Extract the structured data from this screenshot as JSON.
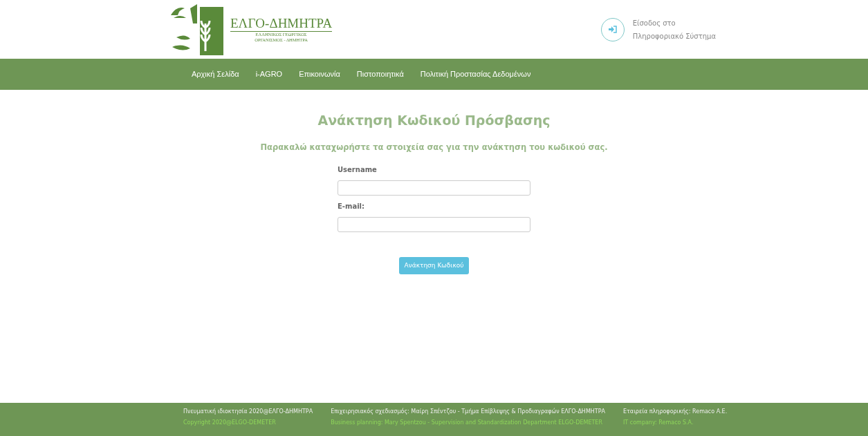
{
  "logo": {
    "title": "ΕΛΓΟ-ΔΗΜΗΤΡΑ",
    "subtitle_lines": [
      "ΕΛΛΗΝΙΚΟΣ ΓΕΩΡΓΙΚΟΣ",
      "ΟΡΓΑΝΙΣΜΟΣ - ΔΗΜΗΤΡΑ"
    ]
  },
  "login_link": {
    "lines": [
      "Είσοδος στο",
      "Πληροφοριακό Σύστημα"
    ]
  },
  "nav": [
    {
      "label": "Αρχική Σελίδα"
    },
    {
      "label": "i-AGRO"
    },
    {
      "label": "Επικοινωνία"
    },
    {
      "label": "Πιστοποιητικά"
    },
    {
      "label": "Πολιτική Προστασίας Δεδομένων"
    }
  ],
  "form": {
    "title": "Ανάκτηση Κωδικού Πρόσβασης",
    "instructions": "Παρακαλώ καταχωρήστε τα στοιχεία σας για την ανάκτηση του κωδικού σας.",
    "fields": [
      {
        "label": "Username"
      },
      {
        "label": "E-mail:"
      }
    ],
    "submit": "Ανάκτηση Κωδικού"
  },
  "footer": [
    {
      "main": "Πνευματική ιδιοκτησία 2020@ΕΛΓΟ-ΔΗΜΗΤΡΑ",
      "sub": "Copyright 2020@ELGO-DEMETER"
    },
    {
      "main": "Επιχειρησιακός σχεδιασμός: Μαίρη Σπέντζου - Τμήμα Επίβλεψης & Προδιαγραφών ΕΛΓΟ-ΔΗΜΗΤΡΑ",
      "sub": "Business planning: Mary Spentzou - Supervision and Standardization Department ELGO-DEMETER"
    },
    {
      "main": "Εταιρεία πληροφορικής: Remaco A.E.",
      "sub": "IT company: Remaco S.A."
    }
  ]
}
